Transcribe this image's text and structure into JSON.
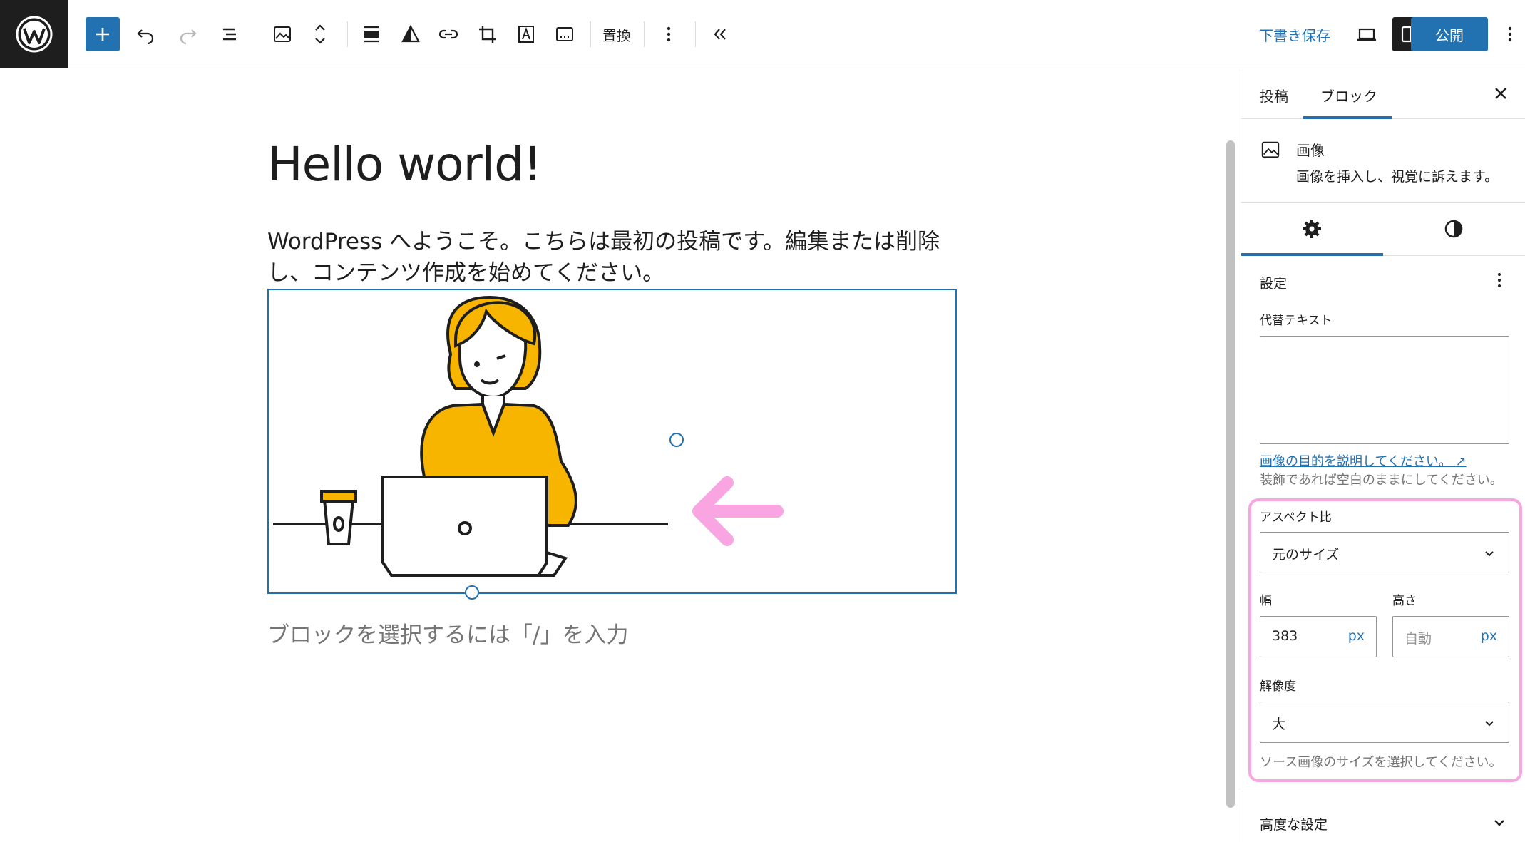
{
  "toolbar": {
    "replace_label": "置換",
    "save_draft": "下書き保存",
    "publish": "公開",
    "icons": [
      "wordpress-logo",
      "add-block",
      "undo",
      "redo",
      "list-view",
      "image",
      "move-up-down",
      "align",
      "duotone",
      "link",
      "crop",
      "text-overlay",
      "caption",
      "options",
      "collapse",
      "preview",
      "settings",
      "more"
    ]
  },
  "editor": {
    "title": "Hello world!",
    "paragraph": "WordPress へようこそ。こちらは最初の投稿です。編集または削除し、コンテンツ作成を始めてください。",
    "placeholder": "ブロックを選択するには「/」を入力"
  },
  "sidebar": {
    "tab_post": "投稿",
    "tab_block": "ブロック",
    "block_name": "画像",
    "block_description": "画像を挿入し、視覚に訴えます。",
    "section_title": "設定",
    "alt_label": "代替テキスト",
    "alt_value": "",
    "alt_link": "画像の目的を説明してください。 ↗",
    "alt_help": "装飾であれば空白のままにしてください。",
    "aspect_label": "アスペクト比",
    "aspect_value": "元のサイズ",
    "width_label": "幅",
    "width_value": "383",
    "height_label": "高さ",
    "height_placeholder": "自動",
    "unit": "px",
    "resolution_label": "解像度",
    "resolution_value": "大",
    "resolution_help": "ソース画像のサイズを選択してください。",
    "advanced": "高度な設定"
  },
  "colors": {
    "accent": "#2271b1",
    "highlight": "#f8a5e1",
    "illustration_yellow": "#f7b500"
  }
}
